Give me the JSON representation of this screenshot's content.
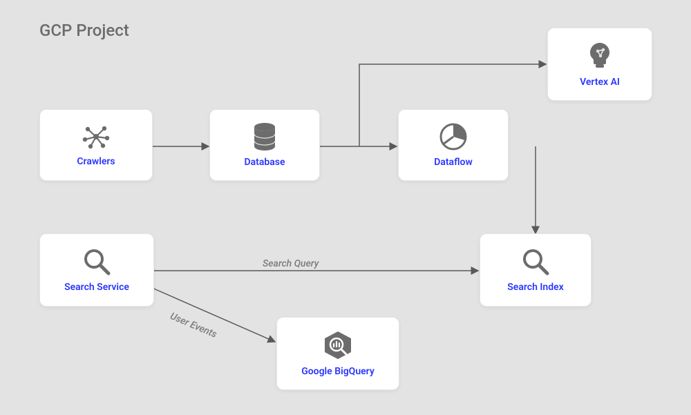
{
  "title": "GCP Project",
  "nodes": {
    "crawlers": {
      "label": "Crawlers"
    },
    "database": {
      "label": "Database"
    },
    "dataflow": {
      "label": "Dataflow"
    },
    "vertex_ai": {
      "label": "Vertex AI"
    },
    "search_service": {
      "label": "Search Service"
    },
    "search_index": {
      "label": "Search Index"
    },
    "bigquery": {
      "label": "Google BigQuery"
    }
  },
  "edges": {
    "search_query": {
      "label": "Search Query"
    },
    "user_events": {
      "label": "User Events"
    }
  },
  "colors": {
    "background": "#e3e3e3",
    "node_bg": "#ffffff",
    "label": "#2a36ff",
    "icon": "#6c6c6c",
    "arrow": "#595959"
  }
}
